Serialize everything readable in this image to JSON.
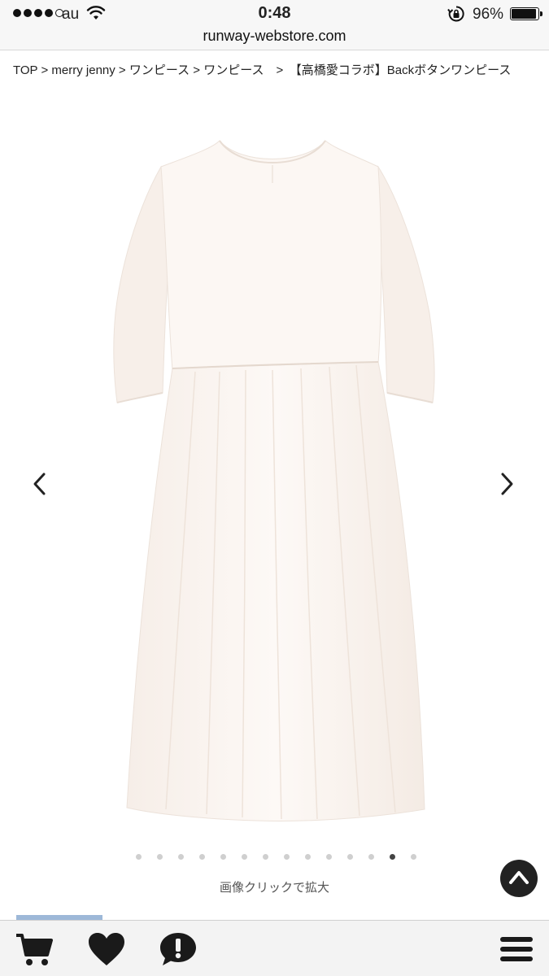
{
  "status_bar": {
    "carrier": "au",
    "time": "0:48",
    "battery_percent": "96%",
    "battery_level": 0.96,
    "signal_bars": 4,
    "signal_max": 5
  },
  "browser": {
    "url": "runway-webstore.com"
  },
  "breadcrumb": {
    "items": [
      "TOP",
      "merry jenny",
      "ワンピース",
      "ワンピース",
      "【高橋愛コラボ】Backボタンワンピース"
    ],
    "separators": [
      " > ",
      " > ",
      " > ",
      "　>　"
    ]
  },
  "gallery": {
    "image_count": 14,
    "active_index": 12,
    "zoom_hint": "画像クリックで拡大",
    "prev_icon": "chevron-left-icon",
    "next_icon": "chevron-right-icon"
  },
  "toolbar": {
    "items": [
      {
        "name": "cart",
        "icon": "cart-icon"
      },
      {
        "name": "favorite",
        "icon": "heart-icon"
      },
      {
        "name": "info",
        "icon": "speech-bubble-exclamation-icon"
      },
      {
        "name": "menu",
        "icon": "hamburger-menu-icon"
      }
    ]
  },
  "colors": {
    "dress": "#fbf5f0",
    "toolbar_bg": "#f3f3f3",
    "active_dot": "#444444",
    "inactive_dot": "#cfcfcf"
  }
}
